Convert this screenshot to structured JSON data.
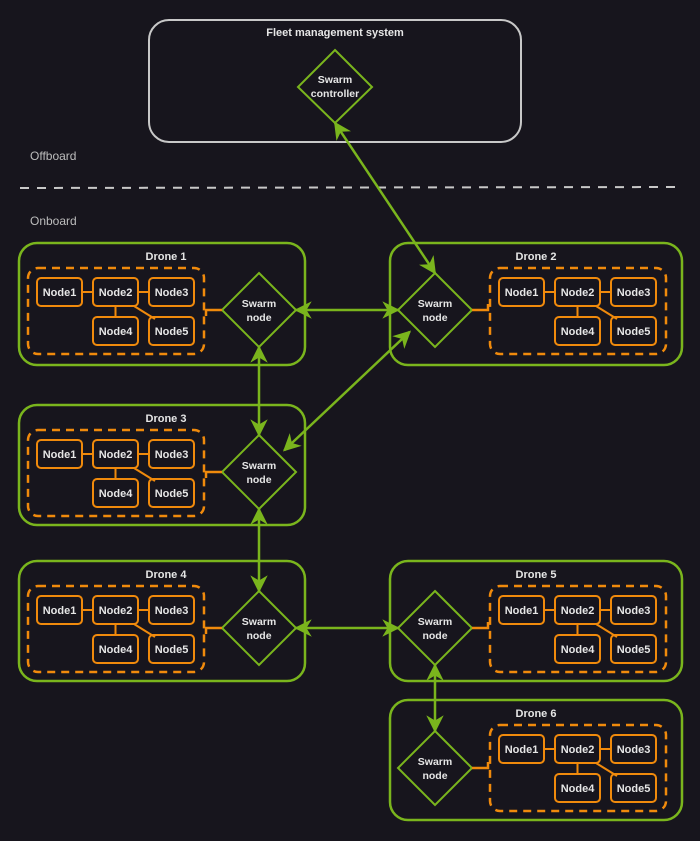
{
  "colors": {
    "background": "#17151d",
    "fleet_border": "#c8c8c8",
    "drone_border": "#7ab51d",
    "swarm_link": "#7ab51d",
    "internal_node": "#f08a0c",
    "text": "#e6e6e6",
    "zone_text": "#bdbdbd",
    "separator": "#c8c8c8"
  },
  "fleet": {
    "title": "Fleet management system",
    "controller_label_line1": "Swarm",
    "controller_label_line2": "controller"
  },
  "zones": {
    "offboard": "Offboard",
    "onboard": "Onboard"
  },
  "swarm_node": {
    "line1": "Swarm",
    "line2": "node"
  },
  "drones": [
    {
      "id": 1,
      "title": "Drone 1",
      "nodes": [
        "Node1",
        "Node2",
        "Node3",
        "Node4",
        "Node5"
      ]
    },
    {
      "id": 2,
      "title": "Drone 2",
      "nodes": [
        "Node1",
        "Node2",
        "Node3",
        "Node4",
        "Node5"
      ]
    },
    {
      "id": 3,
      "title": "Drone 3",
      "nodes": [
        "Node1",
        "Node2",
        "Node3",
        "Node4",
        "Node5"
      ]
    },
    {
      "id": 4,
      "title": "Drone 4",
      "nodes": [
        "Node1",
        "Node2",
        "Node3",
        "Node4",
        "Node5"
      ]
    },
    {
      "id": 5,
      "title": "Drone 5",
      "nodes": [
        "Node1",
        "Node2",
        "Node3",
        "Node4",
        "Node5"
      ]
    },
    {
      "id": 6,
      "title": "Drone 6",
      "nodes": [
        "Node1",
        "Node2",
        "Node3",
        "Node4",
        "Node5"
      ]
    }
  ],
  "internal_edges": [
    [
      "Node1",
      "Node2"
    ],
    [
      "Node2",
      "Node3"
    ],
    [
      "Node2",
      "Node4"
    ],
    [
      "Node2",
      "Node5"
    ]
  ],
  "swarm_links": [
    {
      "from": "controller",
      "to": "Drone 2",
      "bidirectional": true
    },
    {
      "from": "Drone 1",
      "to": "Drone 2",
      "bidirectional": true
    },
    {
      "from": "Drone 1",
      "to": "Drone 3",
      "bidirectional": true
    },
    {
      "from": "Drone 2",
      "to": "Drone 3",
      "bidirectional": true
    },
    {
      "from": "Drone 3",
      "to": "Drone 4",
      "bidirectional": true
    },
    {
      "from": "Drone 4",
      "to": "Drone 5",
      "bidirectional": true
    },
    {
      "from": "Drone 5",
      "to": "Drone 6",
      "bidirectional": true
    }
  ]
}
